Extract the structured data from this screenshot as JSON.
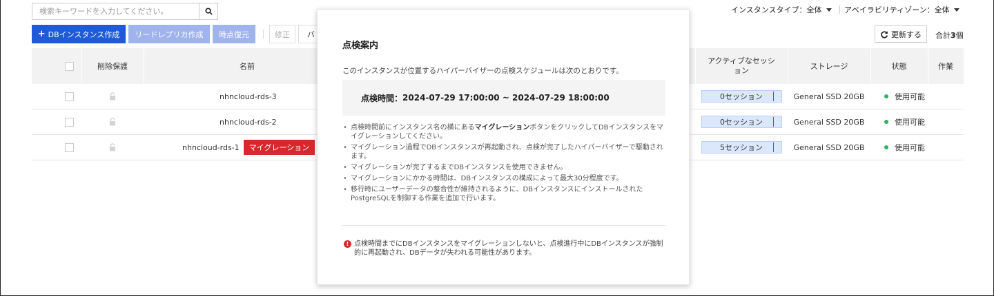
{
  "search": {
    "placeholder": "検索キーワードを入力してください。"
  },
  "filters": {
    "instance_type": "インスタンスタイプ：全体",
    "availability_zone": "アベイラビリティゾーン：全体"
  },
  "toolbar": {
    "create_db": "DBインスタンス作成",
    "create_replica": "リードレプリカ作成",
    "point_restore": "時点復元",
    "edit": "修正",
    "backup_partial": "バ"
  },
  "refresh": {
    "label": "更新する"
  },
  "total": {
    "prefix": "合計",
    "count": "3",
    "suffix": "個"
  },
  "table": {
    "headers": {
      "delete_protection": "削除保護",
      "name": "名前",
      "active_sessions": "アクティブなセッション",
      "storage": "ストレージ",
      "status": "状態",
      "actions": "作業"
    },
    "rows": [
      {
        "name": "nhncloud-rds-3",
        "migration": "",
        "sessions": "0セッション",
        "storage": "General SSD 20GB",
        "status": "使用可能"
      },
      {
        "name": "nhncloud-rds-2",
        "migration": "",
        "sessions": "0セッション",
        "storage": "General SSD 20GB",
        "status": "使用可能"
      },
      {
        "name": "nhncloud-rds-1",
        "migration": "マイグレーション",
        "sessions": "5セッション",
        "storage": "General SSD 20GB",
        "status": "使用可能"
      }
    ]
  },
  "modal": {
    "title": "点検案内",
    "description": "このインスタンスが位置するハイパーバイザーの点検スケジュールは次のとおりです。",
    "time_label": "点検時間：",
    "time_range": "2024-07-29 17:00:00 ~ 2024-07-29 18:00:00",
    "bullet1_pre": "点検時間前にインスタンス名の横にある",
    "bullet1_bold": "マイグレーション",
    "bullet1_post": "ボタンをクリックしてDBインスタンスをマイグレーションしてください。",
    "bullet2": "マイグレーション過程でDBインスタンスが再起動され、点検が完了したハイパーバイザーで駆動されます。",
    "bullet3": "マイグレーションが完了するまでDBインスタンスを使用できません。",
    "bullet4": "マイグレーションにかかる時間は、DBインスタンスの構成によって最大30分程度です。",
    "bullet5": "移行時にユーザーデータの整合性が維持されるように、DBインスタンスにインストールされたPostgreSQLを制御する作業を追加で行います。",
    "warning_icon": "!",
    "warning": "点検時間までにDBインスタンスをマイグレーションしないと、点検進行中にDBインスタンスが強制的に再起動され、DBデータが失われる可能性があります。"
  },
  "colors": {
    "primary": "#1f5bd6",
    "primary_disabled": "#9fb4ec",
    "danger": "#d8282d",
    "status_ok": "#2bb35a",
    "session_fill": "#dbe8fb"
  }
}
